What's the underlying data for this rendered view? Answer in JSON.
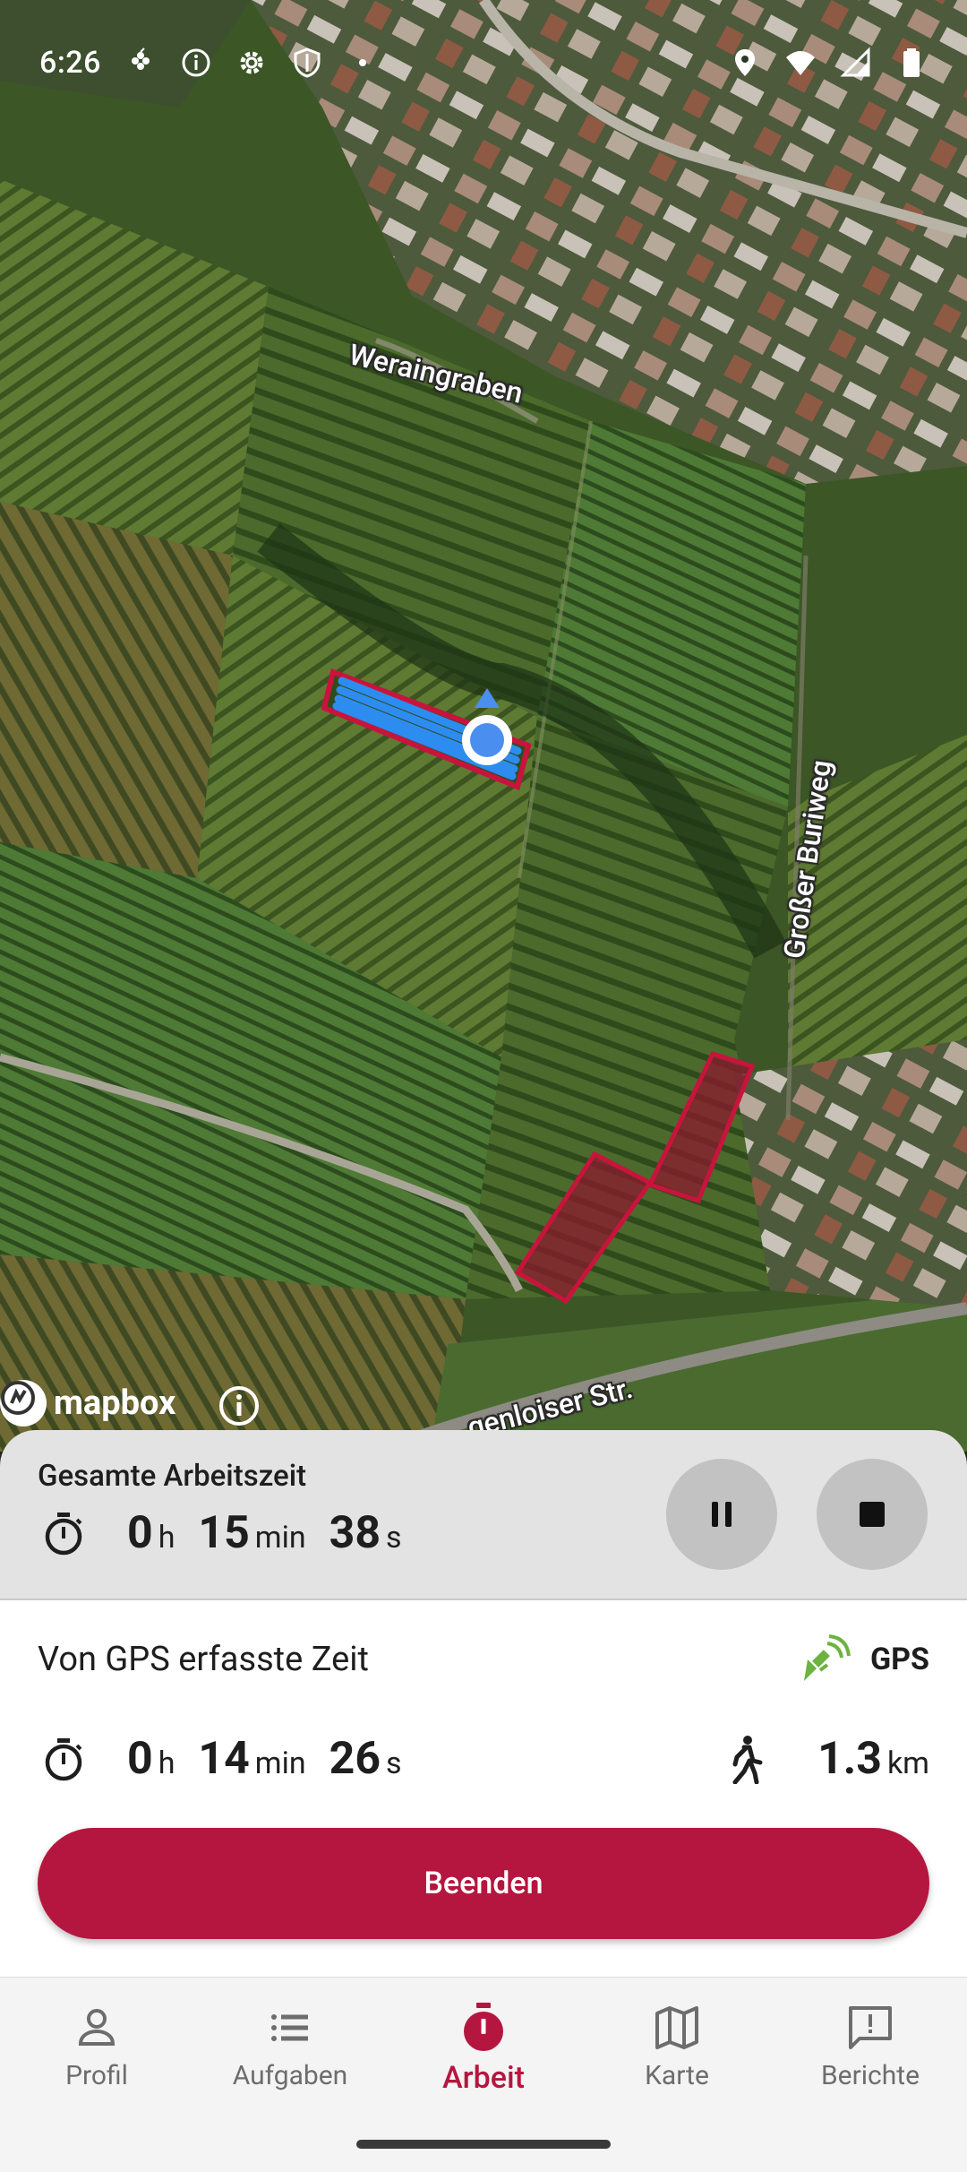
{
  "status_bar": {
    "time": "6:26",
    "left_icons": [
      "vine-icon",
      "info-icon",
      "settings-icon",
      "shield-icon",
      "dot-icon"
    ],
    "right_icons": [
      "location-icon",
      "wifi-icon",
      "signal-icon",
      "battery-icon"
    ]
  },
  "map": {
    "street_labels": [
      "Weraingraben",
      "Großer Buriweg",
      "genloiser Str."
    ],
    "attribution": "mapbox"
  },
  "total_time": {
    "title": "Gesamte Arbeitszeit",
    "hours": "0",
    "hours_unit": "h",
    "minutes": "15",
    "minutes_unit": "min",
    "seconds": "38",
    "seconds_unit": "s"
  },
  "gps_time": {
    "title": "Von GPS erfasste Zeit",
    "gps_label": "GPS",
    "hours": "0",
    "hours_unit": "h",
    "minutes": "14",
    "minutes_unit": "min",
    "seconds": "26",
    "seconds_unit": "s",
    "distance": "1.3",
    "distance_unit": "km"
  },
  "actions": {
    "end_label": "Beenden"
  },
  "nav": {
    "items": [
      {
        "label": "Profil",
        "icon": "person-icon"
      },
      {
        "label": "Aufgaben",
        "icon": "list-icon"
      },
      {
        "label": "Arbeit",
        "icon": "stopwatch-icon",
        "active": true
      },
      {
        "label": "Karte",
        "icon": "map-icon"
      },
      {
        "label": "Berichte",
        "icon": "report-icon"
      }
    ]
  },
  "colors": {
    "accent": "#b5163f",
    "track": "#2d8cf0",
    "field_outline": "#c8143c"
  }
}
